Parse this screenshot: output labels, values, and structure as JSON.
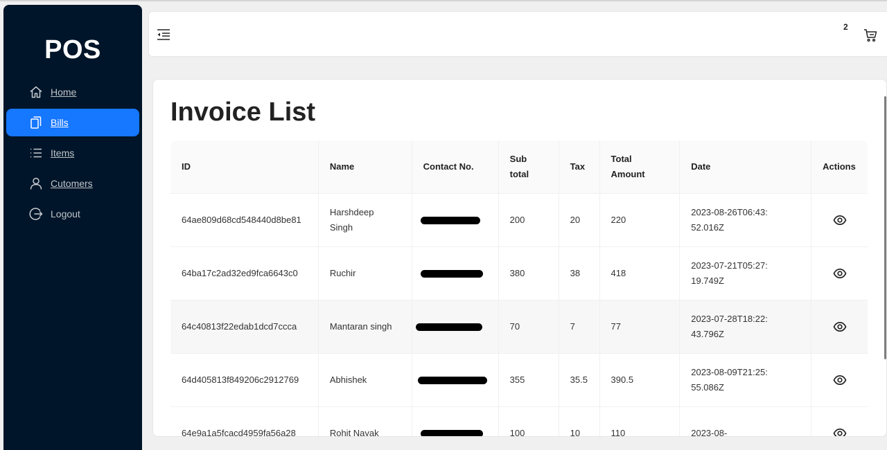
{
  "app": {
    "logo": "POS"
  },
  "sidebar": {
    "items": [
      {
        "label": "Home",
        "icon": "home-icon",
        "active": false
      },
      {
        "label": "Bills",
        "icon": "copy-icon",
        "active": true
      },
      {
        "label": "Items",
        "icon": "list-icon",
        "active": false
      },
      {
        "label": "Cutomers",
        "icon": "user-icon",
        "active": false
      },
      {
        "label": "Logout",
        "icon": "logout-icon",
        "active": false
      }
    ]
  },
  "header": {
    "cart_count": "2",
    "cart_icon": "cart-icon",
    "menu_icon": "menu-fold-icon"
  },
  "page": {
    "title": "Invoice List"
  },
  "table": {
    "columns": [
      "ID",
      "Name",
      "Contact No.",
      "Sub total",
      "Tax",
      "Total Amount",
      "Date",
      "Actions"
    ],
    "rows": [
      {
        "id": "64ae809d68cd548440d8be81",
        "name": "Harshdeep Singh",
        "subtotal": "200",
        "tax": "20",
        "total": "220",
        "date": "2023-08-26T06:43:52.016Z"
      },
      {
        "id": "64ba17c2ad32ed9fca6643c0",
        "name": "Ruchir",
        "subtotal": "380",
        "tax": "38",
        "total": "418",
        "date": "2023-07-21T05:27:19.749Z"
      },
      {
        "id": "64c40813f22edab1dcd7ccca",
        "name": "Mantaran singh",
        "subtotal": "70",
        "tax": "7",
        "total": "77",
        "date": "2023-07-28T18:22:43.796Z"
      },
      {
        "id": "64d405813f849206c2912769",
        "name": "Abhishek",
        "subtotal": "355",
        "tax": "35.5",
        "total": "390.5",
        "date": "2023-08-09T21:25:55.086Z"
      },
      {
        "id": "64e9a1a5fcacd4959fa56a28",
        "name": "Rohit Nayak",
        "subtotal": "100",
        "tax": "10",
        "total": "110",
        "date": "2023-08-"
      }
    ]
  },
  "colors": {
    "sider": "#001529",
    "accent": "#1677ff"
  }
}
